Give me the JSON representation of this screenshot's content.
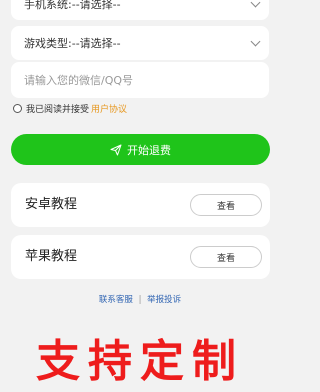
{
  "form": {
    "phone_system_label": "手机系统:",
    "phone_system_value": "--请选择--",
    "game_type_label": "游戏类型:",
    "game_type_value": "--请选择--",
    "contact_placeholder": "请输入您的微信/QQ号",
    "agree_text": "我已阅读并接受",
    "agree_link": "用户协议"
  },
  "actions": {
    "start_label": "开始退费"
  },
  "cards": [
    {
      "title": "安卓教程",
      "button": "查看"
    },
    {
      "title": "苹果教程",
      "button": "查看"
    }
  ],
  "footer": {
    "contact": "联系客服",
    "separator": "|",
    "report": "举报投诉"
  },
  "banner": {
    "text": "支持定制"
  },
  "colors": {
    "accent_green": "#1fc41a",
    "link_orange": "#e79820",
    "link_blue": "#3568b4",
    "banner_red": "#ee1c1c",
    "background": "#f2f2f2"
  }
}
